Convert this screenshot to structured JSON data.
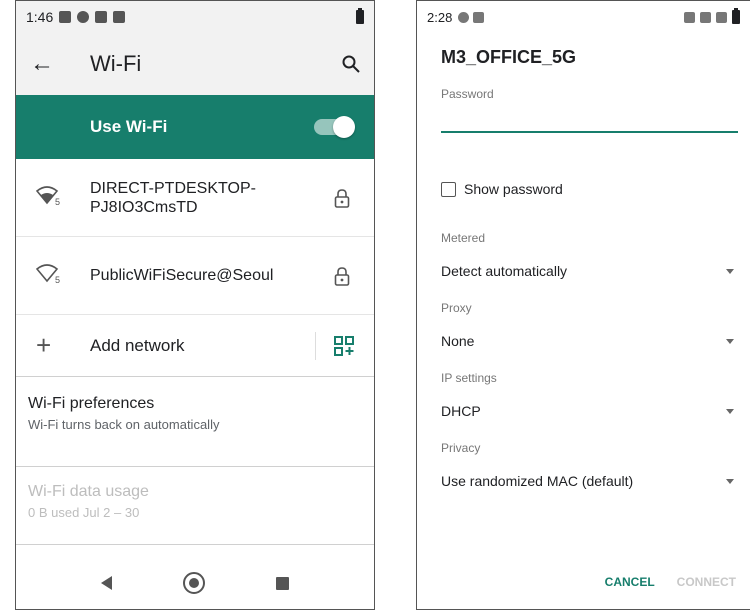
{
  "left_screen": {
    "status_bar": {
      "time": "1:46"
    },
    "app_bar": {
      "title": "Wi-Fi"
    },
    "use_wifi": {
      "label": "Use Wi-Fi",
      "enabled": true
    },
    "networks": [
      {
        "name": "DIRECT-PTDESKTOP-PJ8IO3CmsTD",
        "signal_badge": "5",
        "secured": true
      },
      {
        "name": "PublicWiFiSecure@Seoul",
        "signal_badge": "5",
        "secured": true
      }
    ],
    "add_network": {
      "label": "Add network"
    },
    "preferences": {
      "title": "Wi-Fi preferences",
      "subtitle": "Wi-Fi turns back on automatically"
    },
    "data_usage": {
      "title": "Wi-Fi data usage",
      "subtitle": "0 B used Jul 2 – 30"
    }
  },
  "right_screen": {
    "status_bar": {
      "time": "2:28"
    },
    "dialog": {
      "title": "M3_OFFICE_5G",
      "password_label": "Password",
      "password_value": "",
      "show_password_label": "Show password",
      "show_password_checked": false,
      "metered": {
        "label": "Metered",
        "value": "Detect automatically"
      },
      "proxy": {
        "label": "Proxy",
        "value": "None"
      },
      "ip_settings": {
        "label": "IP settings",
        "value": "DHCP"
      },
      "privacy": {
        "label": "Privacy",
        "value": "Use randomized MAC (default)"
      },
      "actions": {
        "cancel": "CANCEL",
        "connect": "CONNECT"
      }
    }
  },
  "colors": {
    "accent": "#177e6c",
    "app_bar_bg": "#f2f2f2",
    "disabled_text": "#bdbdbd"
  }
}
